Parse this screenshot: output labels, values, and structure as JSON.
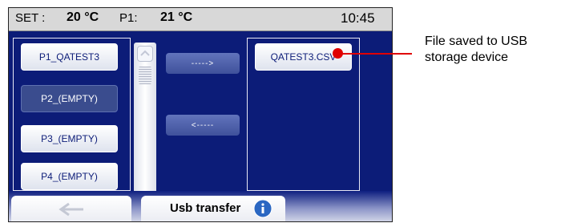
{
  "status_bar": {
    "set_label": "SET :",
    "set_value": "20 °C",
    "p1_label": "P1:",
    "p1_value": "21 °C",
    "time": "10:45"
  },
  "programs": [
    {
      "label": "P1_QATEST3",
      "selected": true
    },
    {
      "label": "P2_(EMPTY)",
      "selected": false
    },
    {
      "label": "P3_(EMPTY)",
      "selected": true
    },
    {
      "label": "P4_(EMPTY)",
      "selected": true
    }
  ],
  "transfer": {
    "to_usb_label": "----->",
    "from_usb_label": "<-----"
  },
  "usb_files": [
    {
      "label": "QATEST3.CSV"
    }
  ],
  "bottom_bar": {
    "back_icon": "back-arrow-icon",
    "title": "Usb transfer",
    "info_icon": "info-icon"
  },
  "annotation": {
    "line1": "File saved to USB",
    "line2": "storage device"
  },
  "colors": {
    "screen_background": "#0c1c78",
    "status_bar": "#d8d8d8",
    "annotation": "#e00000"
  }
}
